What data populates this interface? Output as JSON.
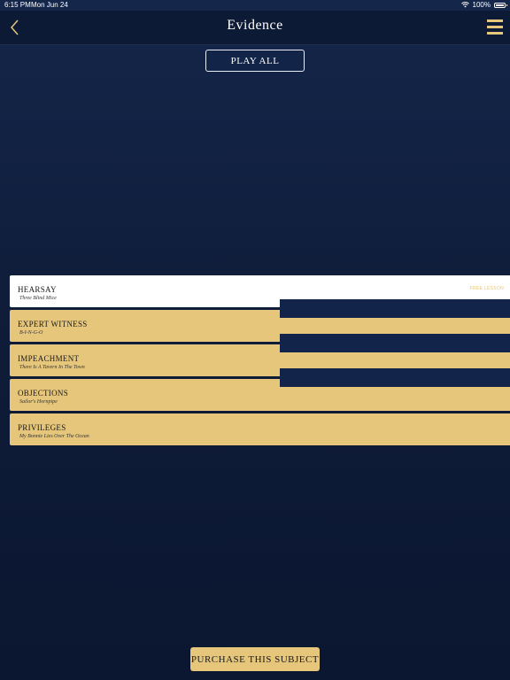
{
  "status_bar": {
    "time": "6:15 PM",
    "date": "Mon Jun 24",
    "battery": "100%"
  },
  "nav": {
    "title": "Evidence",
    "back_icon": "chevron-left-icon",
    "menu_icon": "menu-icon"
  },
  "play_all_label": "PLAY ALL",
  "lessons": [
    {
      "title": "HEARSAY",
      "subtitle": "Three Blind Mice",
      "badge": "FREE LESSON"
    },
    {
      "title": "EXPERT WITNESS",
      "subtitle": "B-I-N-G-O"
    },
    {
      "title": "IMPEACHMENT",
      "subtitle": "There Is A Tavern In The Town"
    },
    {
      "title": "OBJECTIONS",
      "subtitle": "Sailor's Hornpipe"
    },
    {
      "title": "PRIVILEGES",
      "subtitle": "My Bonnie Lies Over The Ocean"
    }
  ],
  "purchase_label": "PURCHASE THIS SUBJECT",
  "colors": {
    "background": "#0f1d3a",
    "accent_gold": "#e5c67b",
    "free_item": "#ffffff"
  }
}
